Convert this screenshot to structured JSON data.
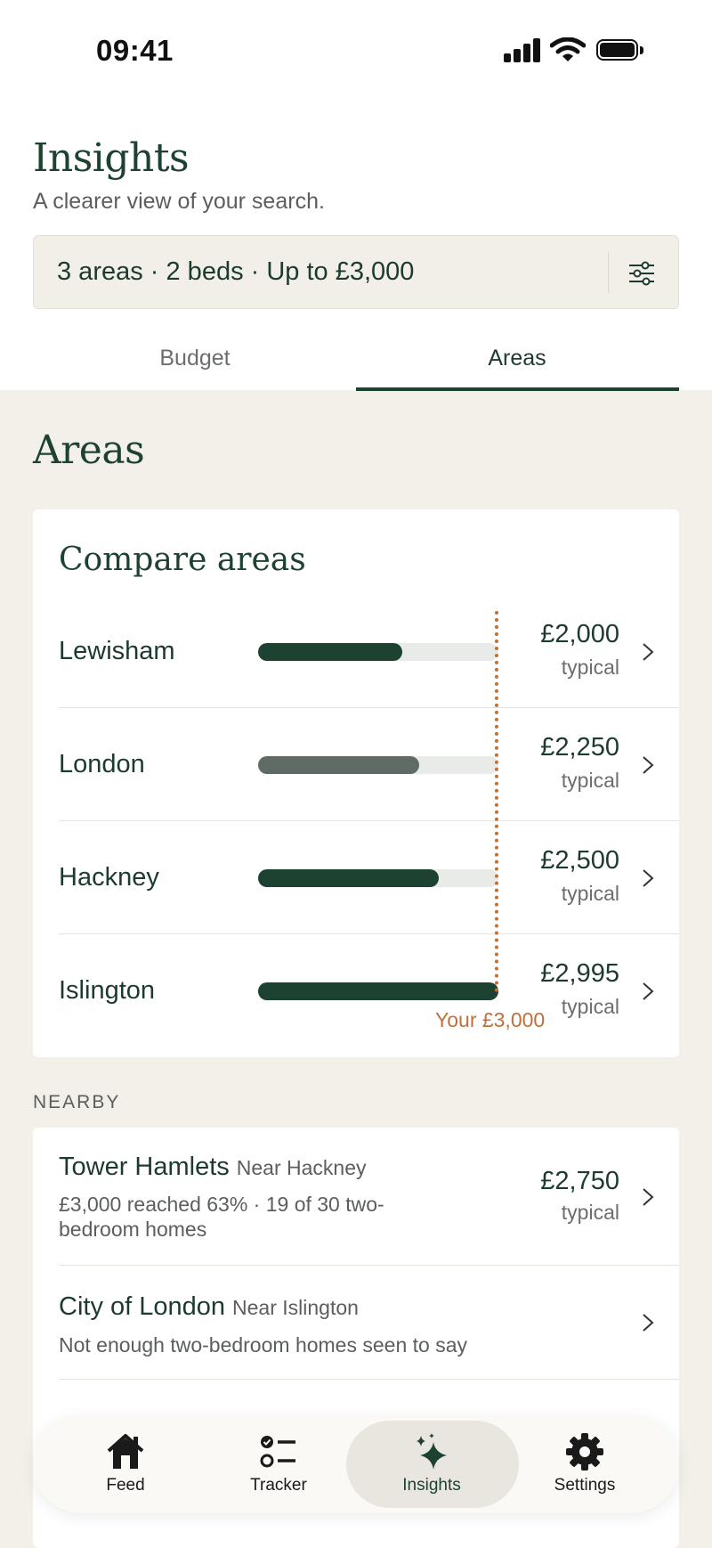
{
  "status_bar": {
    "time": "09:41"
  },
  "header": {
    "title": "Insights",
    "subtitle": "A clearer view of your search.",
    "filter_summary": "3 areas · 2 beds · Up to £3,000"
  },
  "tabs": [
    {
      "label": "Budget",
      "active": false
    },
    {
      "label": "Areas",
      "active": true
    }
  ],
  "section_title": "Areas",
  "compare": {
    "title": "Compare areas",
    "budget_label": "Your £3,000",
    "budget_value": 3000,
    "rows": [
      {
        "name": "Lewisham",
        "price": "£2,000",
        "note": "typical",
        "fill_fraction": 0.6,
        "color": "#1d4231"
      },
      {
        "name": "London",
        "price": "£2,250",
        "note": "typical",
        "fill_fraction": 0.67,
        "color": "#5f6b64"
      },
      {
        "name": "Hackney",
        "price": "£2,500",
        "note": "typical",
        "fill_fraction": 0.75,
        "color": "#1d4231"
      },
      {
        "name": "Islington",
        "price": "£2,995",
        "note": "typical",
        "fill_fraction": 1.0,
        "color": "#1d4231"
      }
    ]
  },
  "nearby": {
    "label": "NEARBY",
    "items": [
      {
        "name": "Tower Hamlets",
        "tag": "Near Hackney",
        "desc": "£3,000 reached 63% · 19 of 30 two-bedroom homes",
        "price": "£2,750",
        "note": "typical"
      },
      {
        "name": "City of London",
        "tag": "Near Islington",
        "desc": "Not enough two-bedroom homes seen to say",
        "price": "",
        "note": ""
      }
    ]
  },
  "nav": [
    {
      "label": "Feed",
      "icon": "home-icon"
    },
    {
      "label": "Tracker",
      "icon": "checklist-icon"
    },
    {
      "label": "Insights",
      "icon": "sparkle-icon",
      "active": true
    },
    {
      "label": "Settings",
      "icon": "gear-icon"
    }
  ]
}
